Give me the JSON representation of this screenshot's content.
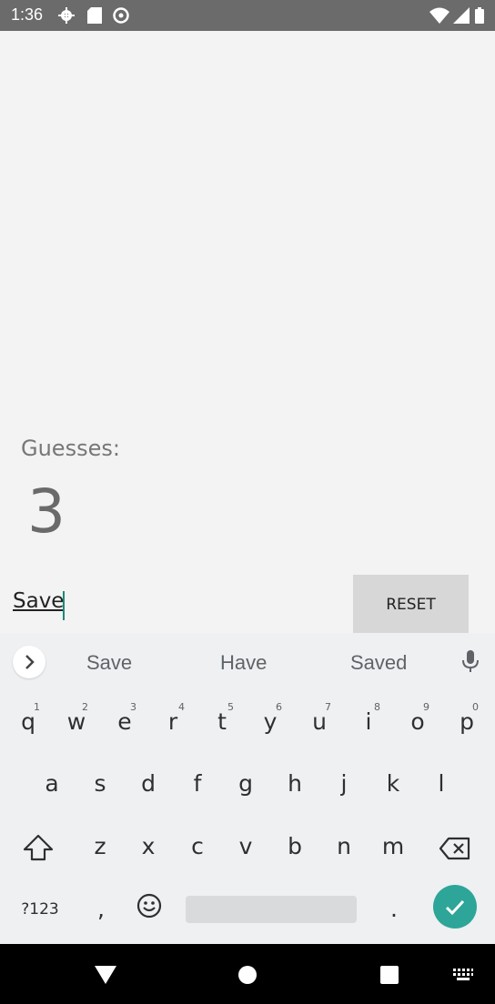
{
  "status_bar": {
    "time": "1:36",
    "left_icons": [
      "gear-icon",
      "sd-card-icon",
      "at-sign-icon"
    ],
    "right_icons": [
      "wifi-icon",
      "signal-icon",
      "battery-icon"
    ]
  },
  "app": {
    "guesses_label": "Guesses:",
    "guesses_count": "3",
    "input_value": "Save",
    "reset_label": "RESET"
  },
  "keyboard": {
    "suggestions": [
      "Save",
      "Have",
      "Saved"
    ],
    "row1": [
      {
        "key": "q",
        "hint": "1"
      },
      {
        "key": "w",
        "hint": "2"
      },
      {
        "key": "e",
        "hint": "3"
      },
      {
        "key": "r",
        "hint": "4"
      },
      {
        "key": "t",
        "hint": "5"
      },
      {
        "key": "y",
        "hint": "6"
      },
      {
        "key": "u",
        "hint": "7"
      },
      {
        "key": "i",
        "hint": "8"
      },
      {
        "key": "o",
        "hint": "9"
      },
      {
        "key": "p",
        "hint": "0"
      }
    ],
    "row2": [
      "a",
      "s",
      "d",
      "f",
      "g",
      "h",
      "j",
      "k",
      "l"
    ],
    "row3": [
      "z",
      "x",
      "c",
      "v",
      "b",
      "n",
      "m"
    ],
    "symbols_label": "?123",
    "comma": ",",
    "period": "."
  },
  "colors": {
    "accent": "#2ea599",
    "status_bar": "#6b6b6b",
    "reset_button": "#d7d7d7"
  }
}
